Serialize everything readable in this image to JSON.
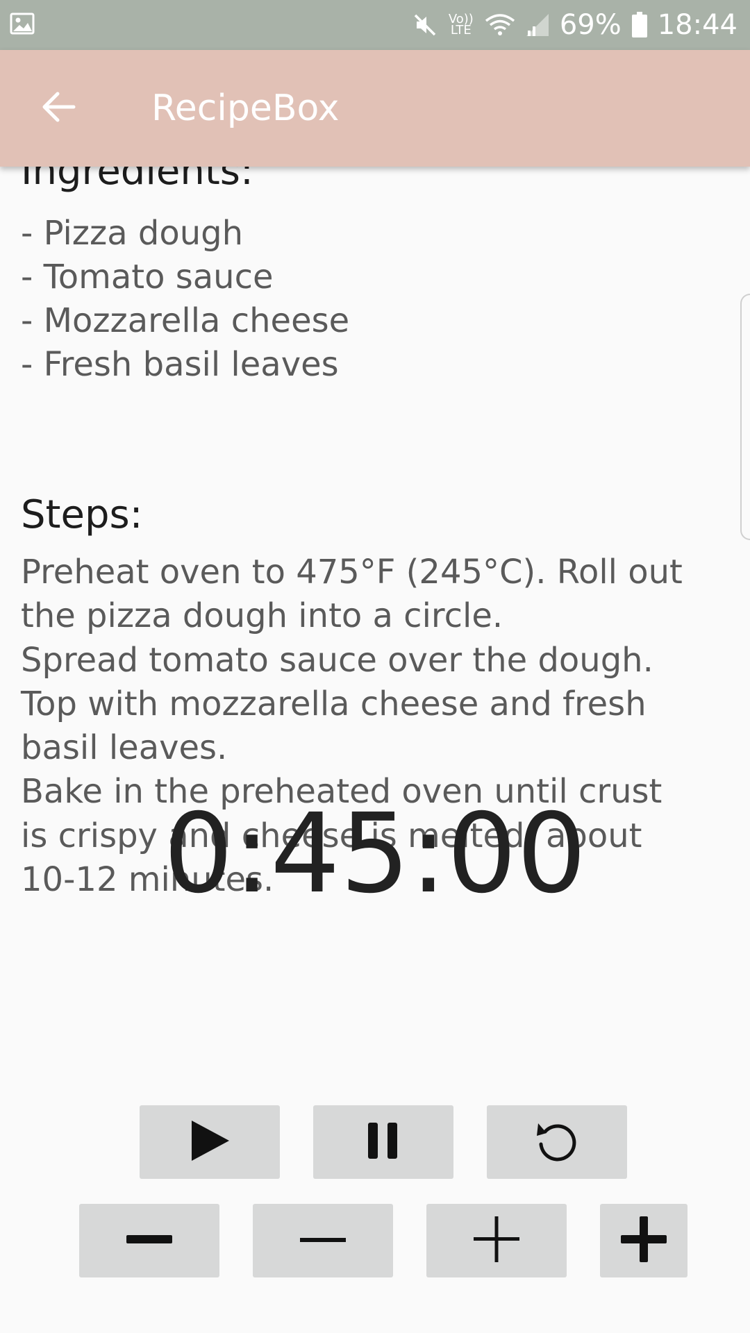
{
  "status_bar": {
    "battery": "69%",
    "time": "18:44",
    "network_label": "Vo)) LTE",
    "icons": [
      "image-icon",
      "mute-icon",
      "volte-icon",
      "wifi-icon",
      "signal-icon",
      "battery-icon"
    ]
  },
  "app_bar": {
    "title": "RecipeBox",
    "back_icon": "arrow-left-icon",
    "color": "#e1c1b6"
  },
  "recipe": {
    "ingredients_title": "Ingredients:",
    "ingredients": [
      "- Pizza dough",
      "- Tomato sauce",
      "- Mozzarella cheese",
      "- Fresh basil leaves"
    ],
    "steps_title": "Steps:",
    "steps_lines": [
      "Preheat oven to 475°F (245°C). Roll out",
      "the pizza dough into a circle.",
      "Spread tomato sauce over the dough.",
      "Top with mozzarella cheese and fresh",
      "basil leaves.",
      "Bake in the preheated oven until crust",
      "is crispy and cheese is melted, about",
      "10-12 minutes."
    ]
  },
  "timer": {
    "display": "0:45:00",
    "controls": [
      "play-icon",
      "pause-icon",
      "reset-icon",
      "minus-bold-icon",
      "minus-icon",
      "plus-icon",
      "plus-bold-icon"
    ],
    "button_color": "#d7d8d8"
  }
}
